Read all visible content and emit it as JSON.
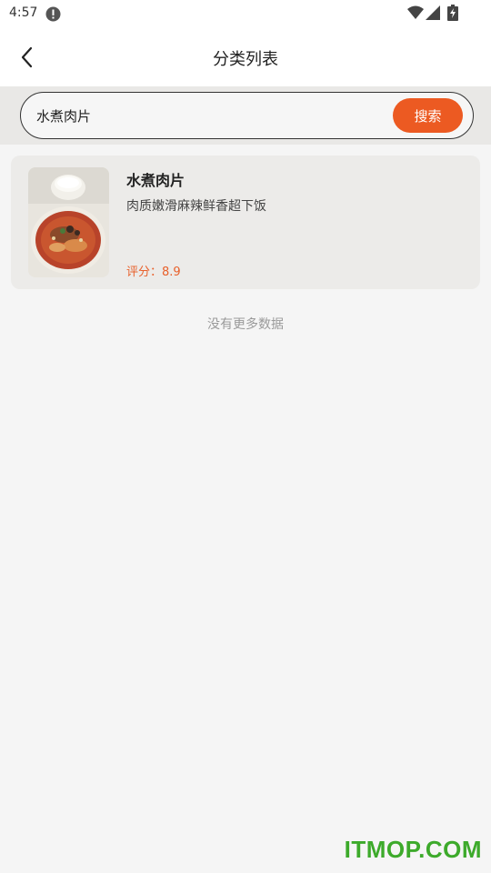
{
  "status_bar": {
    "time": "4:57",
    "icons": [
      "alert-icon",
      "wifi-icon",
      "signal-icon",
      "battery-icon"
    ]
  },
  "nav": {
    "title": "分类列表",
    "back_icon": "back-arrow-icon"
  },
  "search": {
    "value": "水煮肉片",
    "button_label": "搜索",
    "button_color": "#ec5a22"
  },
  "results": [
    {
      "name": "水煮肉片",
      "description": "肉质嫩滑麻辣鲜香超下饭",
      "rating_label": "评分：",
      "rating": "8.9",
      "image": "boiled-pork-slices-photo"
    }
  ],
  "footer_text": "没有更多数据",
  "watermark": "ITMOP.COM",
  "colors": {
    "accent": "#ec5a22",
    "rating": "#e8602b",
    "watermark": "#3daa2b"
  }
}
